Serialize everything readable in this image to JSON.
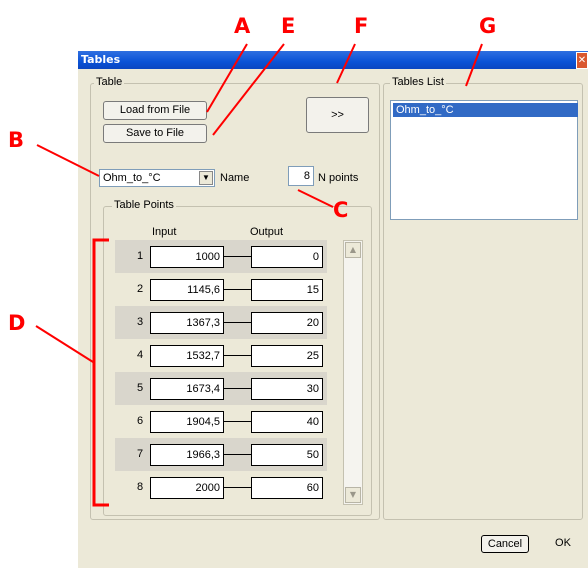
{
  "window": {
    "title": "Tables"
  },
  "table_group": {
    "label": "Table"
  },
  "buttons": {
    "load": "Load from File",
    "save": "Save to File",
    "transfer": ">>",
    "cancel": "Cancel",
    "ok": "OK"
  },
  "table_select": {
    "value": "Ohm_to_°C",
    "name_label": "Name"
  },
  "npoints": {
    "value": "8",
    "label": "N points"
  },
  "points_group": {
    "label": "Table Points",
    "input_header": "Input",
    "output_header": "Output"
  },
  "rows": [
    {
      "index": "1",
      "input": "1000",
      "output": "0"
    },
    {
      "index": "2",
      "input": "1145,6",
      "output": "15"
    },
    {
      "index": "3",
      "input": "1367,3",
      "output": "20"
    },
    {
      "index": "4",
      "input": "1532,7",
      "output": "25"
    },
    {
      "index": "5",
      "input": "1673,4",
      "output": "30"
    },
    {
      "index": "6",
      "input": "1904,5",
      "output": "40"
    },
    {
      "index": "7",
      "input": "1966,3",
      "output": "50"
    },
    {
      "index": "8",
      "input": "2000",
      "output": "60"
    }
  ],
  "tables_list": {
    "label": "Tables List",
    "items": [
      "Ohm_to_°C"
    ]
  },
  "callouts": {
    "a": "A",
    "b": "B",
    "c": "C",
    "d": "D",
    "e": "E",
    "f": "F",
    "g": "G"
  },
  "colors": {
    "callout": "#ff0000",
    "selection": "#316ac5",
    "titlebar": "#0a52d6",
    "dialog_bg": "#ece9d8"
  }
}
